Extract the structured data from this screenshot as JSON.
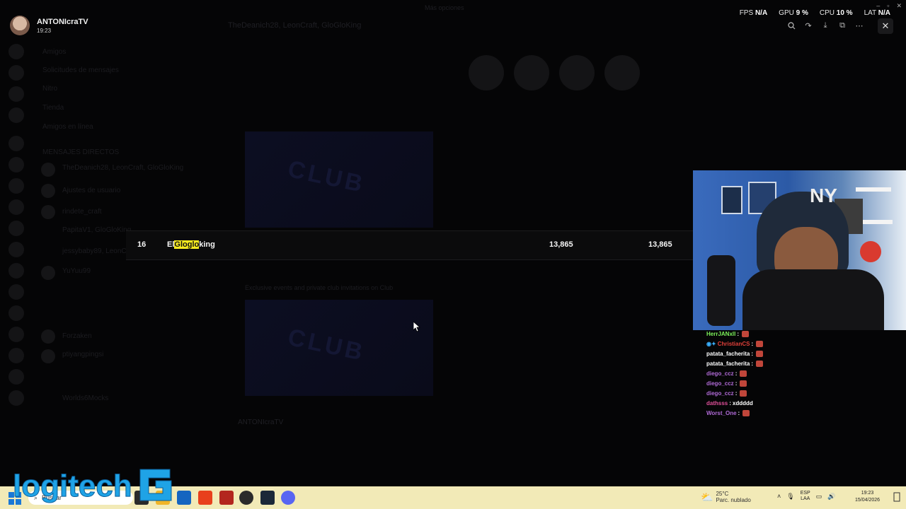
{
  "user": {
    "name": "ANTONIcraTV",
    "time": "19:23"
  },
  "window_title": "Más opciones",
  "background": {
    "sidebar_rows": [
      "Amigos",
      "Solicitudes de mensajes",
      "Nitro",
      "Tienda",
      "Amigos en línea",
      "MENSAJES DIRECTOS",
      "TheDeanich28, LeonCraft, GloGloKing",
      "Ajustes de usuario",
      "rindete_craft",
      "PapitaV1, GloGloKing",
      "jessybaby89, LeonCraft",
      "YuYuu99",
      "Forzaken",
      "ptiyangpingsi",
      "Worlds6Mocks"
    ],
    "header_title": "TheDeanich28, LeonCraft, GloGloKing",
    "subtext": "Exclusive events and private club invitations on Club",
    "message_user": "ANTONIcraTV",
    "club_text": "CLUB"
  },
  "search_row": {
    "rank": "16",
    "name_before": "El",
    "name_highlight": "Gloglo",
    "name_after": "king",
    "value_1": "13,865",
    "value_2": "13,865"
  },
  "stats": [
    {
      "label": "FPS",
      "value": "N/A"
    },
    {
      "label": "GPU",
      "value": "9 %"
    },
    {
      "label": "CPU",
      "value": "10 %"
    },
    {
      "label": "LAT",
      "value": "N/A"
    }
  ],
  "toolbar": {
    "icons": [
      "zoom-icon",
      "share-icon",
      "download-icon",
      "popout-icon",
      "more-icon"
    ],
    "close_label": "✕"
  },
  "chat": [
    {
      "user": "HerrJANxll",
      "color": "#7cf25c",
      "text": "",
      "emote": true
    },
    {
      "user": "ChristianCS",
      "color": "#e0403a",
      "text": "",
      "emote": true,
      "badges": true
    },
    {
      "user": "patata_facherita",
      "color": "#ffffff",
      "text": "",
      "emote": true
    },
    {
      "user": "patata_facherita",
      "color": "#ffffff",
      "text": "",
      "emote": true
    },
    {
      "user": "diego_ccz",
      "color": "#b06ad6",
      "text": "",
      "emote": true
    },
    {
      "user": "diego_ccz",
      "color": "#b06ad6",
      "text": "",
      "emote": true
    },
    {
      "user": "diego_ccz",
      "color": "#b06ad6",
      "text": "",
      "emote": true
    },
    {
      "user": "dathsss",
      "color": "#e0509a",
      "text": "xddddd",
      "emote": false
    },
    {
      "user": "Worst_One",
      "color": "#b06ad6",
      "text": "",
      "emote": true
    }
  ],
  "taskbar": {
    "search_placeholder": "Buscar",
    "weather_temp": "25°C",
    "weather_desc": "Parc. nublado",
    "lang_top": "ESP",
    "lang_bottom": "LAA",
    "clock_time": "19:23",
    "clock_date": "15/04/2026"
  },
  "watermark": "logitech G"
}
